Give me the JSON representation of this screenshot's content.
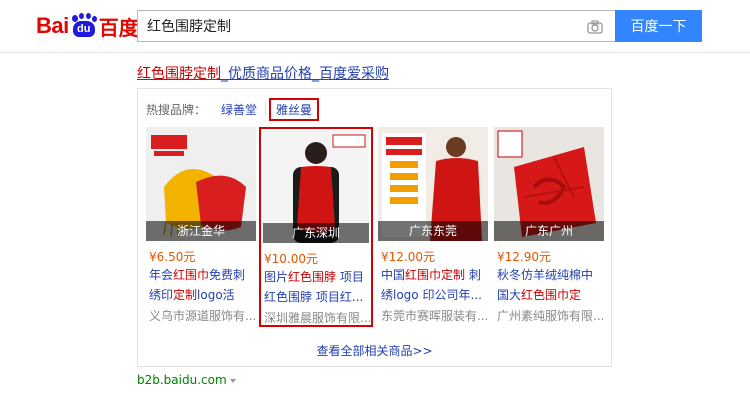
{
  "logo": {
    "text_en": "Bai",
    "paw_text": "du",
    "text_cn": "百度"
  },
  "search": {
    "query": "红色围脖定制",
    "button_label": "百度一下"
  },
  "result": {
    "title_prefix": "红色围脖定制",
    "title_rest": "_优质商品价格_百度爱采购",
    "source": "b2b.baidu.com"
  },
  "brands": {
    "label": "热搜品牌：",
    "items": [
      "绿善堂",
      "雅丝曼"
    ]
  },
  "products": [
    {
      "location": "浙江金华",
      "price": "¥6.50元",
      "name_a": "年会",
      "name_hl1": "红围巾",
      "name_b": "免费刺绣印",
      "name_hl2": "定制",
      "name_c": "logo活动...",
      "shop": "义乌市源道服饰有..."
    },
    {
      "location": "广东深圳",
      "price": "¥10.00元",
      "name_a": "图片",
      "name_hl1": "红色围脖",
      "name_b": " 项目红色围脖 项目红...",
      "name_hl2": "",
      "name_c": "",
      "shop": "深圳雅晨服饰有限..."
    },
    {
      "location": "广东东莞",
      "price": "¥12.00元",
      "name_a": "中国",
      "name_hl1": "红围巾",
      "name_b": "",
      "name_hl2": "定制",
      "name_c": " 刺绣logo 印公司年...",
      "shop": "东莞市赛晖服装有..."
    },
    {
      "location": "广东广州",
      "price": "¥12.90元",
      "name_a": "秋冬仿羊绒纯棉中国大",
      "name_hl1": "红色围巾",
      "name_b": "",
      "name_hl2": "定制",
      "name_c": "...",
      "shop": "广州素纯服饰有限..."
    }
  ],
  "more_link": "查看全部相关商品>>",
  "colors": {
    "accent_blue": "#3385ff",
    "link": "#2440b3",
    "highlight": "#cc0000",
    "price": "#e55600",
    "selection_border": "#d50000"
  }
}
